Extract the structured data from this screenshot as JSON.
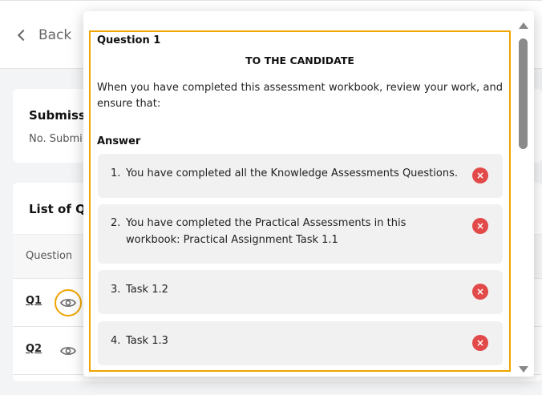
{
  "header": {
    "back_label": "Back"
  },
  "submission_card": {
    "title": "Submissi",
    "subtitle": "No. Submi"
  },
  "questions_card": {
    "title": "List of Qu",
    "column_header": "Question",
    "rows": [
      {
        "label": "Q1"
      },
      {
        "label": "Q2"
      }
    ]
  },
  "modal": {
    "question_title": "Question 1",
    "heading": "TO THE CANDIDATE",
    "instruction": "When you have completed this assessment workbook, review your work, and ensure that:",
    "answer_label": "Answer",
    "answers": [
      {
        "num": "1.",
        "text": "You have completed all the Knowledge Assessments Questions."
      },
      {
        "num": "2.",
        "text": "You have completed the Practical Assessments in this workbook: Practical Assignment Task 1.1"
      },
      {
        "num": "3.",
        "text": "Task 1.2"
      },
      {
        "num": "4.",
        "text": "Task 1.3"
      }
    ],
    "delete_symbol": "×"
  },
  "colors": {
    "highlight": "#f0a500",
    "delete": "#e24a4a"
  }
}
